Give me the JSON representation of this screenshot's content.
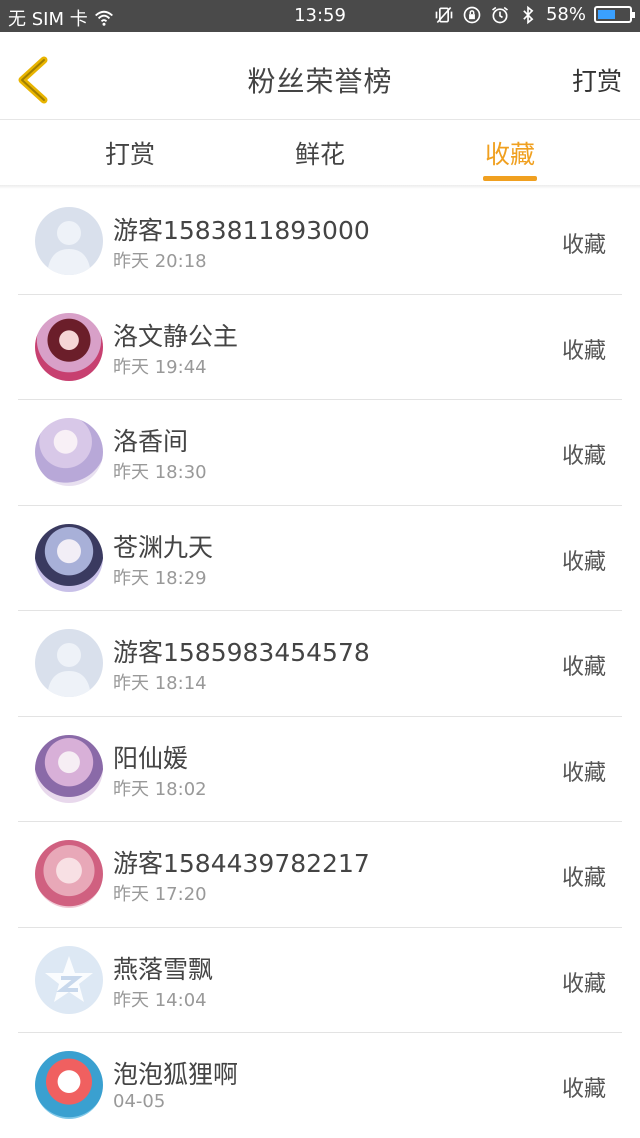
{
  "status_bar": {
    "carrier": "无 SIM 卡",
    "time": "13:59",
    "battery_percent": "58%",
    "battery_level": 0.58
  },
  "header": {
    "title": "粉丝荣誉榜",
    "action": "打赏"
  },
  "tabs": [
    {
      "label": "打赏",
      "active": false
    },
    {
      "label": "鲜花",
      "active": false
    },
    {
      "label": "收藏",
      "active": true
    }
  ],
  "colors": {
    "accent": "#f0a020",
    "status_bar_bg": "#4a4a4a"
  },
  "rows": [
    {
      "name": "游客1583811893000",
      "time": "昨天 20:18",
      "action": "收藏",
      "avatar": "default-avatar-icon"
    },
    {
      "name": "洛文静公主",
      "time": "昨天 19:44",
      "action": "收藏",
      "avatar": "user-avatar"
    },
    {
      "name": "洛香间",
      "time": "昨天 18:30",
      "action": "收藏",
      "avatar": "user-avatar"
    },
    {
      "name": "苍渊九天",
      "time": "昨天 18:29",
      "action": "收藏",
      "avatar": "user-avatar"
    },
    {
      "name": "游客1585983454578",
      "time": "昨天 18:14",
      "action": "收藏",
      "avatar": "default-avatar-icon"
    },
    {
      "name": "阳仙媛",
      "time": "昨天 18:02",
      "action": "收藏",
      "avatar": "user-avatar"
    },
    {
      "name": "游客1584439782217",
      "time": "昨天 17:20",
      "action": "收藏",
      "avatar": "user-avatar"
    },
    {
      "name": "燕落雪飘",
      "time": "昨天 14:04",
      "action": "收藏",
      "avatar": "qzone-avatar-icon"
    },
    {
      "name": "泡泡狐狸啊",
      "time": "04-05",
      "action": "收藏",
      "avatar": "user-avatar"
    }
  ]
}
